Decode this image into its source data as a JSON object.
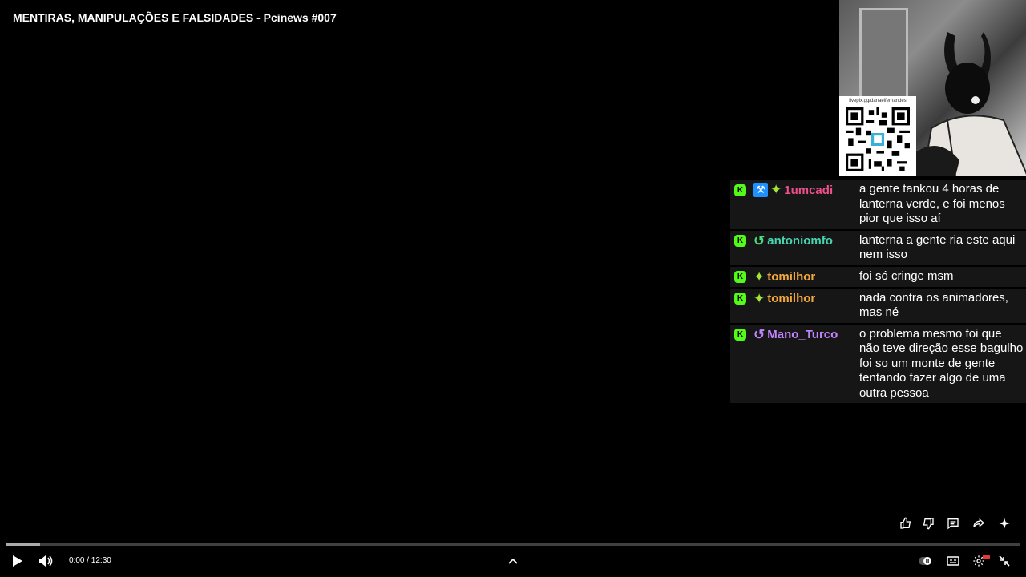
{
  "video": {
    "title": "MENTIRAS, MANIPULAÇÕES E FALSIDADES - Pcinews #007"
  },
  "overlay": {
    "qr_url": "livepix.gg/danaelfernandes"
  },
  "chat": [
    {
      "username": "1umcadi",
      "color": "#ef4f8a",
      "badges": [
        "hammer-icon",
        "sparkle-icon"
      ],
      "message": "a gente tankou 4 horas de lanterna verde, e foi menos pior que isso aí"
    },
    {
      "username": "antoniomfo",
      "color": "#45d6b0",
      "badges": [
        "return-icon"
      ],
      "message": "lanterna a gente ria este aqui nem isso"
    },
    {
      "username": "tomilhor",
      "color": "#f2a93b",
      "badges": [
        "sparkle-icon"
      ],
      "message": "foi só cringe msm"
    },
    {
      "username": "tomilhor",
      "color": "#f2a93b",
      "badges": [
        "sparkle-icon"
      ],
      "message": "nada contra os animadores, mas né"
    },
    {
      "username": "Mano_Turco",
      "color": "#c084fc",
      "badges": [
        "return-icon"
      ],
      "message": "o problema mesmo foi que não teve direção esse bagulho foi so um monte de gente tentando fazer algo de uma outra pessoa"
    }
  ],
  "player": {
    "time": "0:00 / 12:30",
    "progress_fraction": 0.0
  },
  "colors": {
    "kick_green": "#53fc18",
    "background": "#000000"
  }
}
